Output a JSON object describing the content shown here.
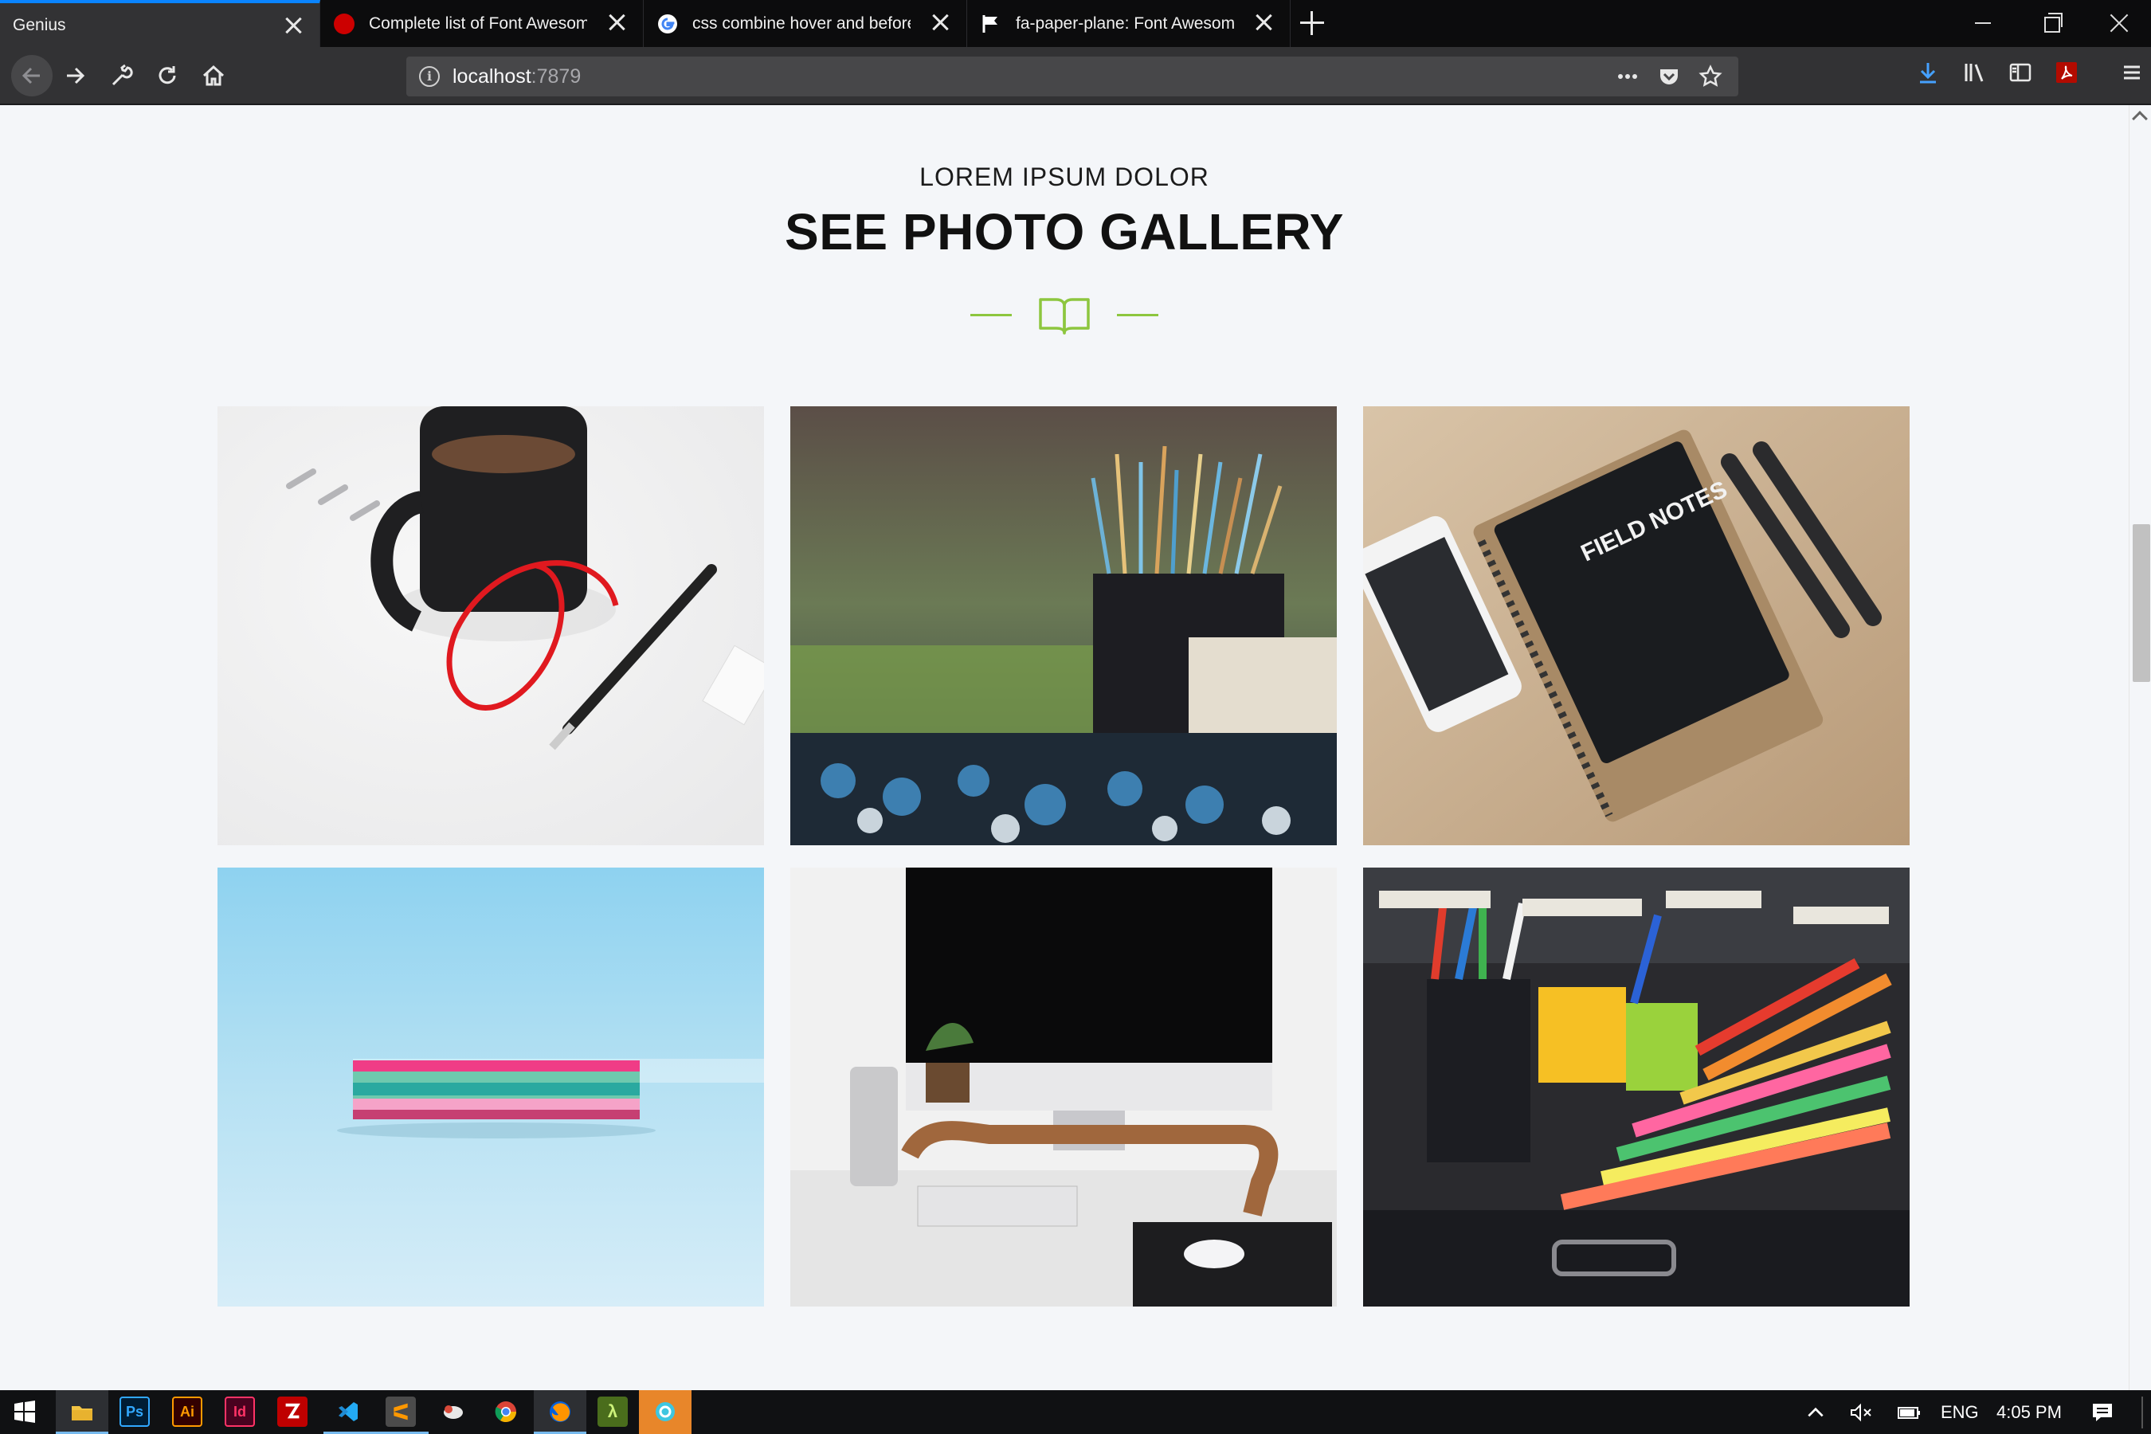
{
  "browser": {
    "tabs": [
      {
        "title": "Genius",
        "active": true
      },
      {
        "title": "Complete list of Font Awesome",
        "active": false,
        "favicon": "red-circle-icon"
      },
      {
        "title": "css combine hover and before",
        "active": false,
        "favicon": "google-g-icon"
      },
      {
        "title": "fa-paper-plane: Font Awesome",
        "active": false,
        "favicon": "flag-icon"
      }
    ],
    "url": {
      "host": "localhost",
      "port": ":7879"
    },
    "accent_color": "#0a84ff"
  },
  "section": {
    "kicker": "LOREM IPSUM DOLOR",
    "title": "SEE PHOTO GALLERY",
    "divider_icon": "book-open-icon",
    "accent_color": "#8dc63f"
  },
  "gallery": [
    {
      "name": "gallery-photo-coffee-mug"
    },
    {
      "name": "gallery-photo-paint-brushes"
    },
    {
      "name": "gallery-photo-field-notes",
      "caption_on_image": "FIELD NOTES"
    },
    {
      "name": "gallery-photo-sticky-notes"
    },
    {
      "name": "gallery-photo-imac-desk"
    },
    {
      "name": "gallery-photo-stationery-box"
    }
  ],
  "taskbar": {
    "apps": [
      "file-explorer-icon",
      "photoshop-icon",
      "illustrator-icon",
      "indesign-icon",
      "filezilla-icon",
      "vscode-icon",
      "sublime-icon",
      "bird-app-icon",
      "chrome-icon",
      "firefox-icon",
      "lambda-icon",
      "app-icon"
    ],
    "app_labels": {
      "photoshop": "Ps",
      "illustrator": "Ai",
      "indesign": "Id",
      "lambda": "λ"
    },
    "language": "ENG",
    "time": "4:05 PM"
  }
}
